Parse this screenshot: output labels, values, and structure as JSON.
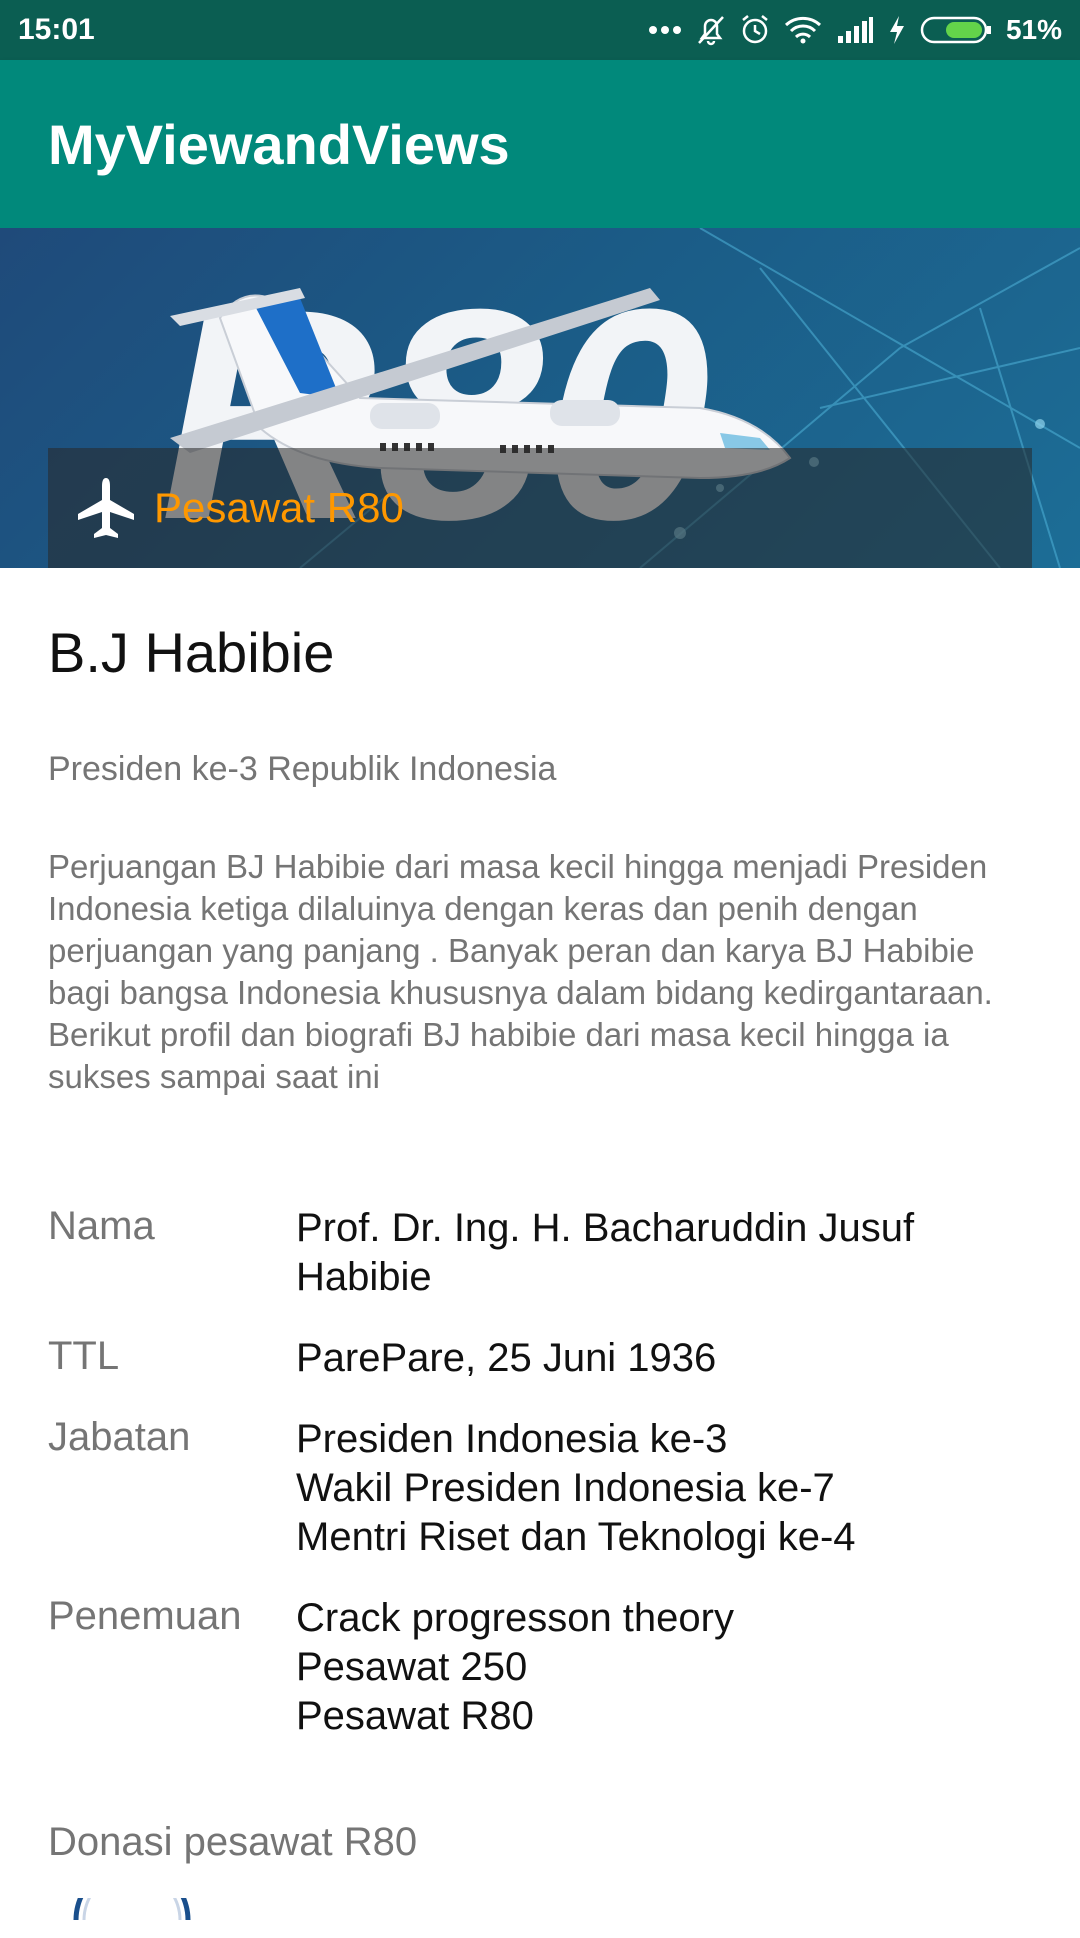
{
  "status_bar": {
    "time": "15:01",
    "battery_percent": "51%",
    "icons": [
      "more-dots-icon",
      "bell-off-icon",
      "alarm-icon",
      "wifi-icon",
      "signal-icon",
      "charging-icon",
      "battery-icon"
    ]
  },
  "app_bar": {
    "title": "MyViewandViews"
  },
  "hero": {
    "image_text": "R80",
    "caption": "Pesawat R80",
    "caption_icon": "airplane-icon",
    "caption_color": "#ff9800"
  },
  "profile": {
    "name": "B.J Habibie",
    "subtitle": "Presiden ke-3 Republik Indonesia",
    "description": "Perjuangan BJ Habibie dari masa kecil hingga menjadi Presiden Indonesia ketiga dilaluinya dengan keras dan penih dengan perjuangan yang panjang . Banyak peran dan karya BJ Habibie bagi bangsa Indonesia khususnya dalam bidang kedirgantaraan. Berikut profil dan biografi BJ habibie dari masa kecil hingga ia sukses sampai saat ini"
  },
  "info": [
    {
      "label": "Nama",
      "value": "Prof. Dr. Ing. H. Bacharuddin Jusuf\nHabibie"
    },
    {
      "label": "TTL",
      "value": "ParePare, 25 Juni 1936"
    },
    {
      "label": "Jabatan",
      "value": "Presiden Indonesia ke-3\n Wakil Presiden Indonesia ke-7\n Mentri Riset dan Teknologi ke-4"
    },
    {
      "label": "Penemuan",
      "value": "Crack progresson theory\n Pesawat 250\n Pesawat R80"
    }
  ],
  "donation": {
    "label": "Donasi pesawat R80"
  },
  "colors": {
    "status_bar": "#0b5e52",
    "app_bar": "#01897b",
    "accent": "#ff9800"
  }
}
